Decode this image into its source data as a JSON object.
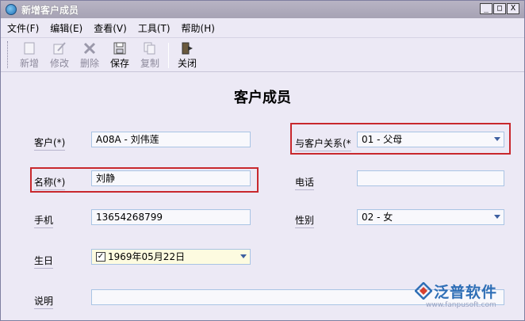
{
  "window": {
    "title": "新增客户成员",
    "controls": {
      "minimize": "_",
      "maximize": "□",
      "close": "X"
    }
  },
  "menu": {
    "items": [
      "文件(F)",
      "编辑(E)",
      "查看(V)",
      "工具(T)",
      "帮助(H)"
    ]
  },
  "toolbar": {
    "buttons": [
      {
        "label": "新增",
        "icon": "new-doc-icon",
        "enabled": false
      },
      {
        "label": "修改",
        "icon": "edit-icon",
        "enabled": false
      },
      {
        "label": "删除",
        "icon": "delete-x-icon",
        "enabled": false
      },
      {
        "label": "保存",
        "icon": "save-disk-icon",
        "enabled": true
      },
      {
        "label": "复制",
        "icon": "copy-icon",
        "enabled": false
      },
      {
        "label": "关闭",
        "icon": "exit-door-icon",
        "enabled": true
      }
    ]
  },
  "form": {
    "title": "客户成员",
    "customer": {
      "label": "客户(*)",
      "value": "A08A - 刘伟莲"
    },
    "relation": {
      "label": "与客户关系(*",
      "value": "01 - 父母"
    },
    "name": {
      "label": "名称(*)",
      "value": "刘静"
    },
    "phone": {
      "label": "电话",
      "value": ""
    },
    "mobile": {
      "label": "手机",
      "value": "13654268799"
    },
    "gender": {
      "label": "性别",
      "value": "02 - 女"
    },
    "birthday": {
      "label": "生日",
      "value": "1969年05月22日",
      "checked": true
    },
    "note": {
      "label": "说明",
      "value": ""
    }
  },
  "watermark": {
    "brand": "泛普软件",
    "url": "www.fanpusoft.com"
  },
  "colors": {
    "highlight": "#c8282d",
    "window_bg": "#ece9f5",
    "field_border": "#a9c4e4"
  }
}
